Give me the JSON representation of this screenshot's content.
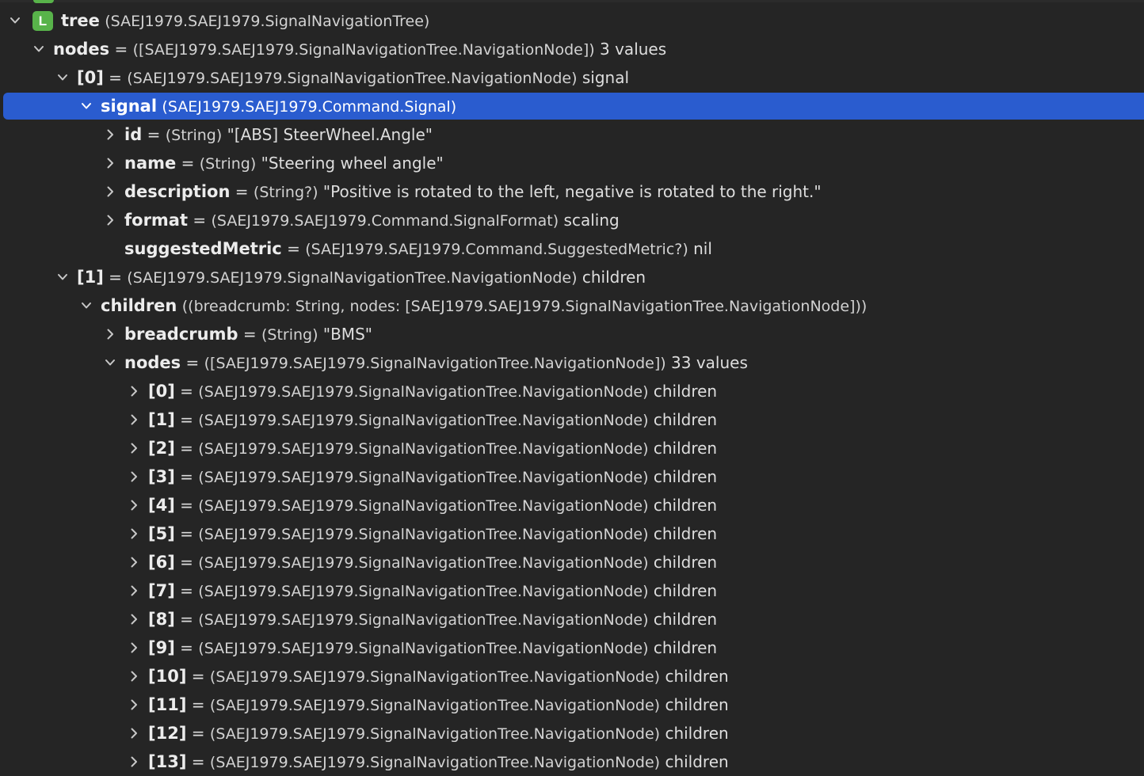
{
  "rows": [
    {
      "depth": 0,
      "chevron": "down",
      "badge": "L",
      "name": "tree",
      "eq": "",
      "type": "(SAEJ1979.SAEJ1979.SignalNavigationTree)",
      "value": ""
    },
    {
      "depth": 1,
      "chevron": "down",
      "name": "nodes",
      "eq": "=",
      "type": "([SAEJ1979.SAEJ1979.SignalNavigationTree.NavigationNode])",
      "value": "3 values"
    },
    {
      "depth": 2,
      "chevron": "down",
      "name": "[0]",
      "eq": "=",
      "type": "(SAEJ1979.SAEJ1979.SignalNavigationTree.NavigationNode)",
      "value": "signal"
    },
    {
      "depth": 3,
      "chevron": "down",
      "name": "signal",
      "eq": "",
      "type": "(SAEJ1979.SAEJ1979.Command.Signal)",
      "value": "",
      "selected": true
    },
    {
      "depth": 4,
      "chevron": "right",
      "name": "id",
      "eq": "=",
      "type": "(String)",
      "value": "\"[ABS] SteerWheel.Angle\""
    },
    {
      "depth": 4,
      "chevron": "right",
      "name": "name",
      "eq": "=",
      "type": "(String)",
      "value": "\"Steering wheel angle\""
    },
    {
      "depth": 4,
      "chevron": "right",
      "name": "description",
      "eq": "=",
      "type": "(String?)",
      "value": "\"Positive is rotated to the left, negative is rotated to the right.\""
    },
    {
      "depth": 4,
      "chevron": "right",
      "name": "format",
      "eq": "=",
      "type": "(SAEJ1979.SAEJ1979.Command.SignalFormat)",
      "value": "scaling"
    },
    {
      "depth": 4,
      "chevron": "none",
      "name": "suggestedMetric",
      "eq": "=",
      "type": "(SAEJ1979.SAEJ1979.Command.SuggestedMetric?)",
      "value": "nil"
    },
    {
      "depth": 2,
      "chevron": "down",
      "name": "[1]",
      "eq": "=",
      "type": "(SAEJ1979.SAEJ1979.SignalNavigationTree.NavigationNode)",
      "value": "children"
    },
    {
      "depth": 3,
      "chevron": "down",
      "name": "children",
      "eq": "",
      "type": "((breadcrumb: String, nodes: [SAEJ1979.SAEJ1979.SignalNavigationTree.NavigationNode]))",
      "value": ""
    },
    {
      "depth": 4,
      "chevron": "right",
      "name": "breadcrumb",
      "eq": "=",
      "type": "(String)",
      "value": "\"BMS\""
    },
    {
      "depth": 4,
      "chevron": "down",
      "name": "nodes",
      "eq": "=",
      "type": "([SAEJ1979.SAEJ1979.SignalNavigationTree.NavigationNode])",
      "value": "33 values"
    },
    {
      "depth": 5,
      "chevron": "right",
      "name": "[0]",
      "eq": "=",
      "type": "(SAEJ1979.SAEJ1979.SignalNavigationTree.NavigationNode)",
      "value": "children"
    },
    {
      "depth": 5,
      "chevron": "right",
      "name": "[1]",
      "eq": "=",
      "type": "(SAEJ1979.SAEJ1979.SignalNavigationTree.NavigationNode)",
      "value": "children"
    },
    {
      "depth": 5,
      "chevron": "right",
      "name": "[2]",
      "eq": "=",
      "type": "(SAEJ1979.SAEJ1979.SignalNavigationTree.NavigationNode)",
      "value": "children"
    },
    {
      "depth": 5,
      "chevron": "right",
      "name": "[3]",
      "eq": "=",
      "type": "(SAEJ1979.SAEJ1979.SignalNavigationTree.NavigationNode)",
      "value": "children"
    },
    {
      "depth": 5,
      "chevron": "right",
      "name": "[4]",
      "eq": "=",
      "type": "(SAEJ1979.SAEJ1979.SignalNavigationTree.NavigationNode)",
      "value": "children"
    },
    {
      "depth": 5,
      "chevron": "right",
      "name": "[5]",
      "eq": "=",
      "type": "(SAEJ1979.SAEJ1979.SignalNavigationTree.NavigationNode)",
      "value": "children"
    },
    {
      "depth": 5,
      "chevron": "right",
      "name": "[6]",
      "eq": "=",
      "type": "(SAEJ1979.SAEJ1979.SignalNavigationTree.NavigationNode)",
      "value": "children"
    },
    {
      "depth": 5,
      "chevron": "right",
      "name": "[7]",
      "eq": "=",
      "type": "(SAEJ1979.SAEJ1979.SignalNavigationTree.NavigationNode)",
      "value": "children"
    },
    {
      "depth": 5,
      "chevron": "right",
      "name": "[8]",
      "eq": "=",
      "type": "(SAEJ1979.SAEJ1979.SignalNavigationTree.NavigationNode)",
      "value": "children"
    },
    {
      "depth": 5,
      "chevron": "right",
      "name": "[9]",
      "eq": "=",
      "type": "(SAEJ1979.SAEJ1979.SignalNavigationTree.NavigationNode)",
      "value": "children"
    },
    {
      "depth": 5,
      "chevron": "right",
      "name": "[10]",
      "eq": "=",
      "type": "(SAEJ1979.SAEJ1979.SignalNavigationTree.NavigationNode)",
      "value": "children"
    },
    {
      "depth": 5,
      "chevron": "right",
      "name": "[11]",
      "eq": "=",
      "type": "(SAEJ1979.SAEJ1979.SignalNavigationTree.NavigationNode)",
      "value": "children"
    },
    {
      "depth": 5,
      "chevron": "right",
      "name": "[12]",
      "eq": "=",
      "type": "(SAEJ1979.SAEJ1979.SignalNavigationTree.NavigationNode)",
      "value": "children"
    },
    {
      "depth": 5,
      "chevron": "right",
      "name": "[13]",
      "eq": "=",
      "type": "(SAEJ1979.SAEJ1979.SignalNavigationTree.NavigationNode)",
      "value": "children"
    }
  ],
  "colors": {
    "background": "#252525",
    "selection": "#2a5ccf",
    "local_badge": "#58b34a"
  },
  "icons": {
    "expanded": "chevron-down-icon",
    "collapsed": "chevron-right-icon",
    "local_variable": "local-variable-badge-icon"
  }
}
